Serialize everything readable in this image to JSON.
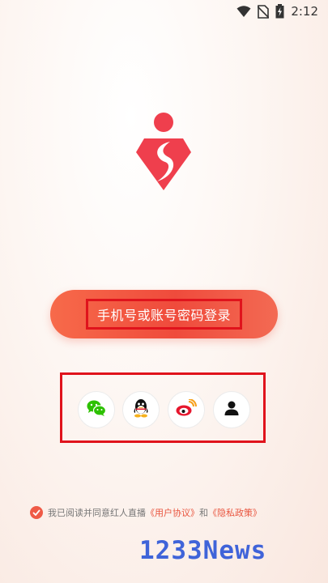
{
  "status_bar": {
    "time": "2:12",
    "icons": [
      "wifi-icon",
      "no-sim-icon",
      "battery-charging-icon"
    ]
  },
  "app": {
    "logo": "diamond-s-logo"
  },
  "login": {
    "button_label": "手机号或账号密码登录"
  },
  "social_login": {
    "options": [
      {
        "name": "wechat",
        "icon": "wechat-icon",
        "color": "#2dc100"
      },
      {
        "name": "qq",
        "icon": "qq-penguin-icon",
        "color": "#000000"
      },
      {
        "name": "weibo",
        "icon": "weibo-icon",
        "color": "#e6162d"
      },
      {
        "name": "account",
        "icon": "user-icon",
        "color": "#111111"
      }
    ]
  },
  "agreement": {
    "prefix": "我已阅读并同意红人直播",
    "user_agreement": "《用户协议》",
    "conjunction": "和",
    "privacy_policy": "《隐私政策》",
    "checked": true
  },
  "watermark": {
    "text": "1233News"
  },
  "colors": {
    "accent": "#ef4b3c",
    "highlight_box": "#e0131c",
    "link": "#e9553f"
  }
}
